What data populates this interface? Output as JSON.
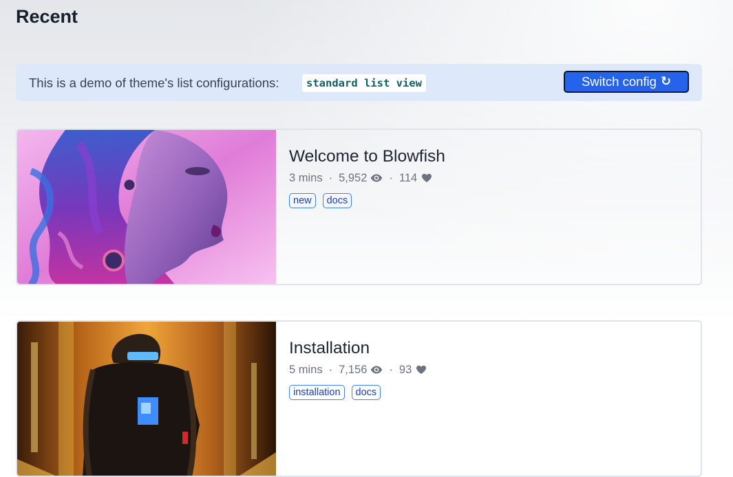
{
  "page": {
    "title": "Recent"
  },
  "banner": {
    "text": "This is a demo of theme's list configurations:",
    "config_name": "standard list view",
    "switch_button_label": "Switch config",
    "switch_button_icon": "refresh-icon"
  },
  "articles": [
    {
      "title": "Welcome to Blowfish",
      "reading_time": "3 mins",
      "views": "5,952",
      "likes": "114",
      "tags": [
        "new",
        "docs"
      ],
      "thumbnail": "fantasy-woman-portrait-image"
    },
    {
      "title": "Installation",
      "reading_time": "5 mins",
      "views": "7,156",
      "likes": "93",
      "tags": [
        "installation",
        "docs"
      ],
      "thumbnail": "cyberpunk-figure-image"
    }
  ],
  "meta_separator": "·",
  "colors": {
    "accent": "#2563eb",
    "banner_bg": "#dde9fb",
    "code_text": "#0f5f63",
    "tag_border": "#3b82f6",
    "meta_text": "#6b7280"
  }
}
